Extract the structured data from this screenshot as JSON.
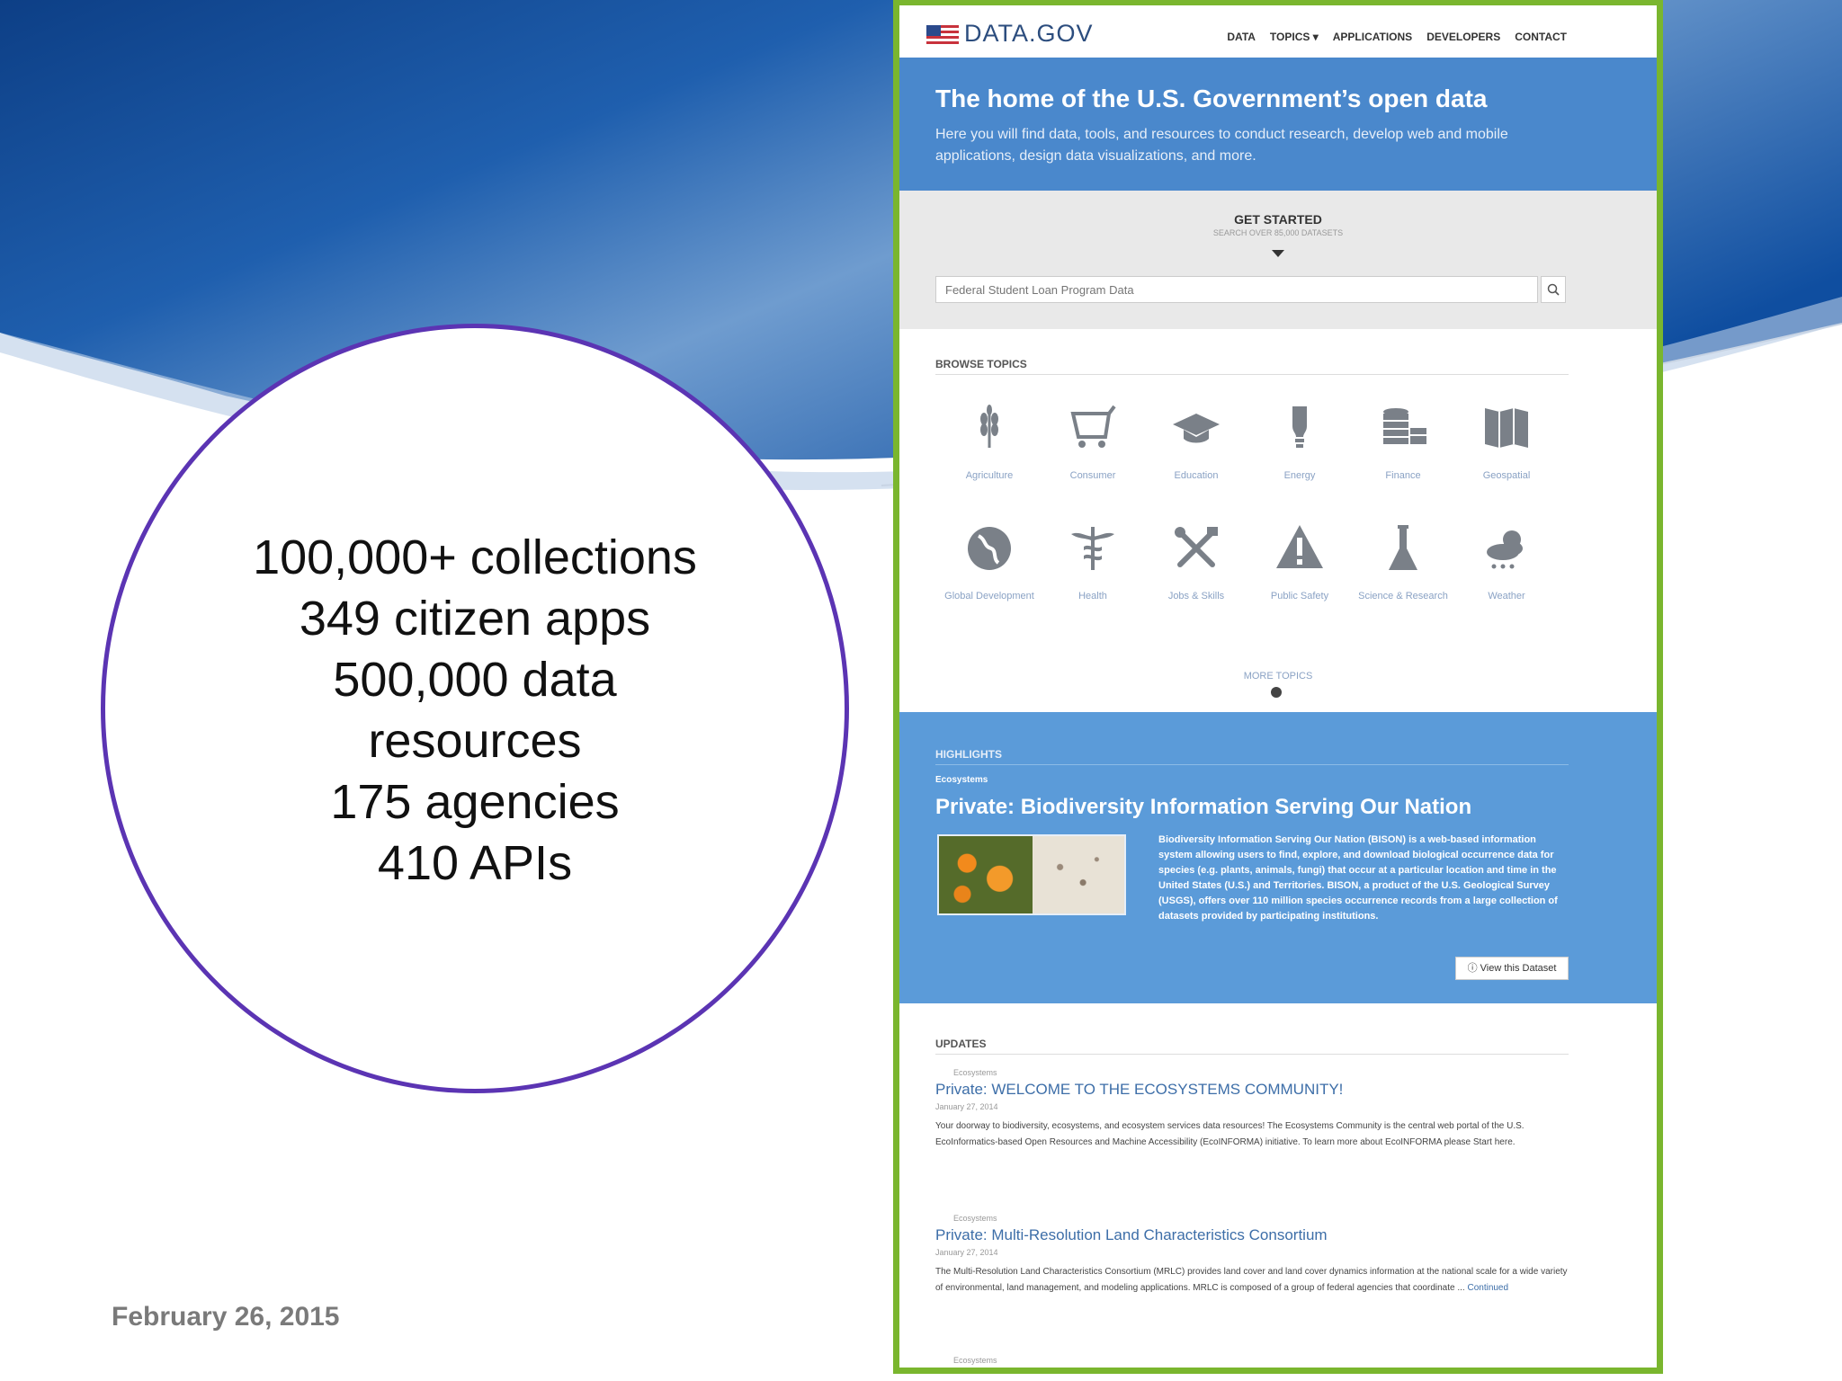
{
  "slide": {
    "stats": [
      "100,000+ collections",
      "349 citizen apps",
      "500,000 data",
      "resources",
      "175 agencies",
      "410 APIs"
    ],
    "date": "February 26, 2015"
  },
  "site": {
    "logo": "DATA.GOV",
    "nav": [
      "DATA",
      "TOPICS ▾",
      "APPLICATIONS",
      "DEVELOPERS",
      "CONTACT"
    ],
    "hero": {
      "title": "The home of the U.S. Government’s open data",
      "subtitle": "Here you will find data, tools, and resources to conduct research, develop web and mobile applications, design data visualizations, and more."
    },
    "get_started": {
      "title": "GET STARTED",
      "subtitle": "SEARCH OVER 85,000 DATASETS",
      "search_placeholder": "Federal Student Loan Program Data"
    },
    "browse_label": "BROWSE TOPICS",
    "topics": [
      {
        "label": "Agriculture",
        "icon": "wheat-icon"
      },
      {
        "label": "Consumer",
        "icon": "shopping-cart-icon"
      },
      {
        "label": "Education",
        "icon": "graduation-cap-icon"
      },
      {
        "label": "Energy",
        "icon": "light-bulb-icon"
      },
      {
        "label": "Finance",
        "icon": "coins-icon"
      },
      {
        "label": "Geospatial",
        "icon": "map-icon"
      },
      {
        "label": "Global Development",
        "icon": "globe-icon"
      },
      {
        "label": "Health",
        "icon": "caduceus-icon"
      },
      {
        "label": "Jobs & Skills",
        "icon": "tools-icon"
      },
      {
        "label": "Public Safety",
        "icon": "warning-icon"
      },
      {
        "label": "Science & Research",
        "icon": "flask-icon"
      },
      {
        "label": "Weather",
        "icon": "weather-icon"
      }
    ],
    "more_topics": "MORE TOPICS",
    "highlights": {
      "label": "HIGHLIGHTS",
      "category": "Ecosystems",
      "title": "Private: Biodiversity Information Serving Our Nation",
      "description": "Biodiversity Information Serving Our Nation (BISON) is a web-based information system allowing users to find, explore, and download biological occurrence data for species (e.g. plants, animals, fungi) that occur at a particular location and time in the United States (U.S.) and Territories. BISON, a product of the U.S. Geological Survey (USGS), offers over 110 million species occurrence records from a large collection of datasets provided by participating institutions.",
      "button": "ⓘ View this Dataset"
    },
    "updates": {
      "label": "UPDATES",
      "items": [
        {
          "category": "Ecosystems",
          "title": "Private: WELCOME TO THE ECOSYSTEMS COMMUNITY!",
          "date": "January 27, 2014",
          "body": "Your doorway to biodiversity, ecosystems, and ecosystem services data resources! The Ecosystems Community is the central web portal of the U.S. EcoInformatics-based Open Resources and Machine Accessibility (EcoINFORMA) initiative. To learn more about EcoINFORMA please Start here."
        },
        {
          "category": "Ecosystems",
          "title": "Private: Multi-Resolution Land Characteristics Consortium",
          "date": "January 27, 2014",
          "body": "The Multi-Resolution Land Characteristics Consortium (MRLC) provides land cover and land cover dynamics information at the national scale for a wide variety of environmental, land management, and modeling applications. MRLC is composed of a group of federal agencies that coordinate ...",
          "link": "Continued"
        },
        {
          "category": "Ecosystems"
        }
      ]
    }
  }
}
